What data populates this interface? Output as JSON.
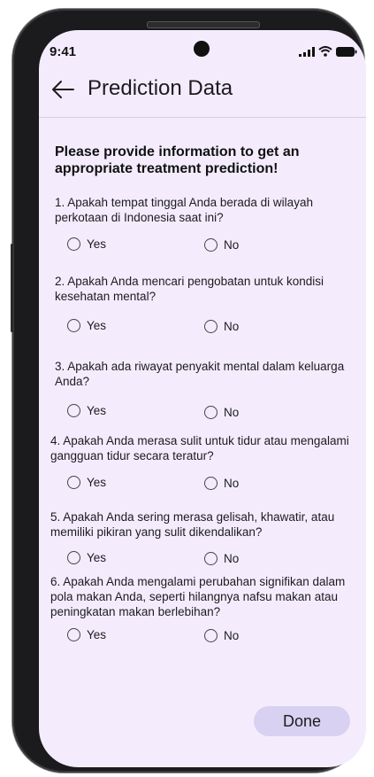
{
  "status": {
    "time": "9:41"
  },
  "appbar": {
    "title": "Prediction Data"
  },
  "intro": "Please provide information to get an appropriate treatment prediction!",
  "questions": [
    {
      "text": "1. Apakah tempat tinggal Anda berada di wilayah perkotaan di Indonesia saat ini?",
      "yes": "Yes",
      "no": "No"
    },
    {
      "text": "2. Apakah Anda mencari pengobatan untuk kondisi kesehatan mental?",
      "yes": "Yes",
      "no": "No"
    },
    {
      "text": "3. Apakah ada riwayat penyakit mental dalam keluarga Anda?",
      "yes": "Yes",
      "no": "No"
    },
    {
      "text": "4. Apakah Anda merasa sulit untuk tidur atau mengalami gangguan tidur secara teratur?",
      "yes": "Yes",
      "no": "No"
    },
    {
      "text": "5. Apakah Anda sering merasa gelisah, khawatir, atau memiliki pikiran yang sulit dikendalikan?",
      "yes": "Yes",
      "no": "No"
    },
    {
      "text": "6. Apakah Anda mengalami perubahan signifikan dalam pola makan Anda, seperti hilangnya nafsu makan atau peningkatan makan berlebihan?",
      "yes": "Yes",
      "no": "No"
    }
  ],
  "done_label": "Done",
  "colors": {
    "background": "#f4ecfd",
    "done_button": "#d9d1f2"
  }
}
